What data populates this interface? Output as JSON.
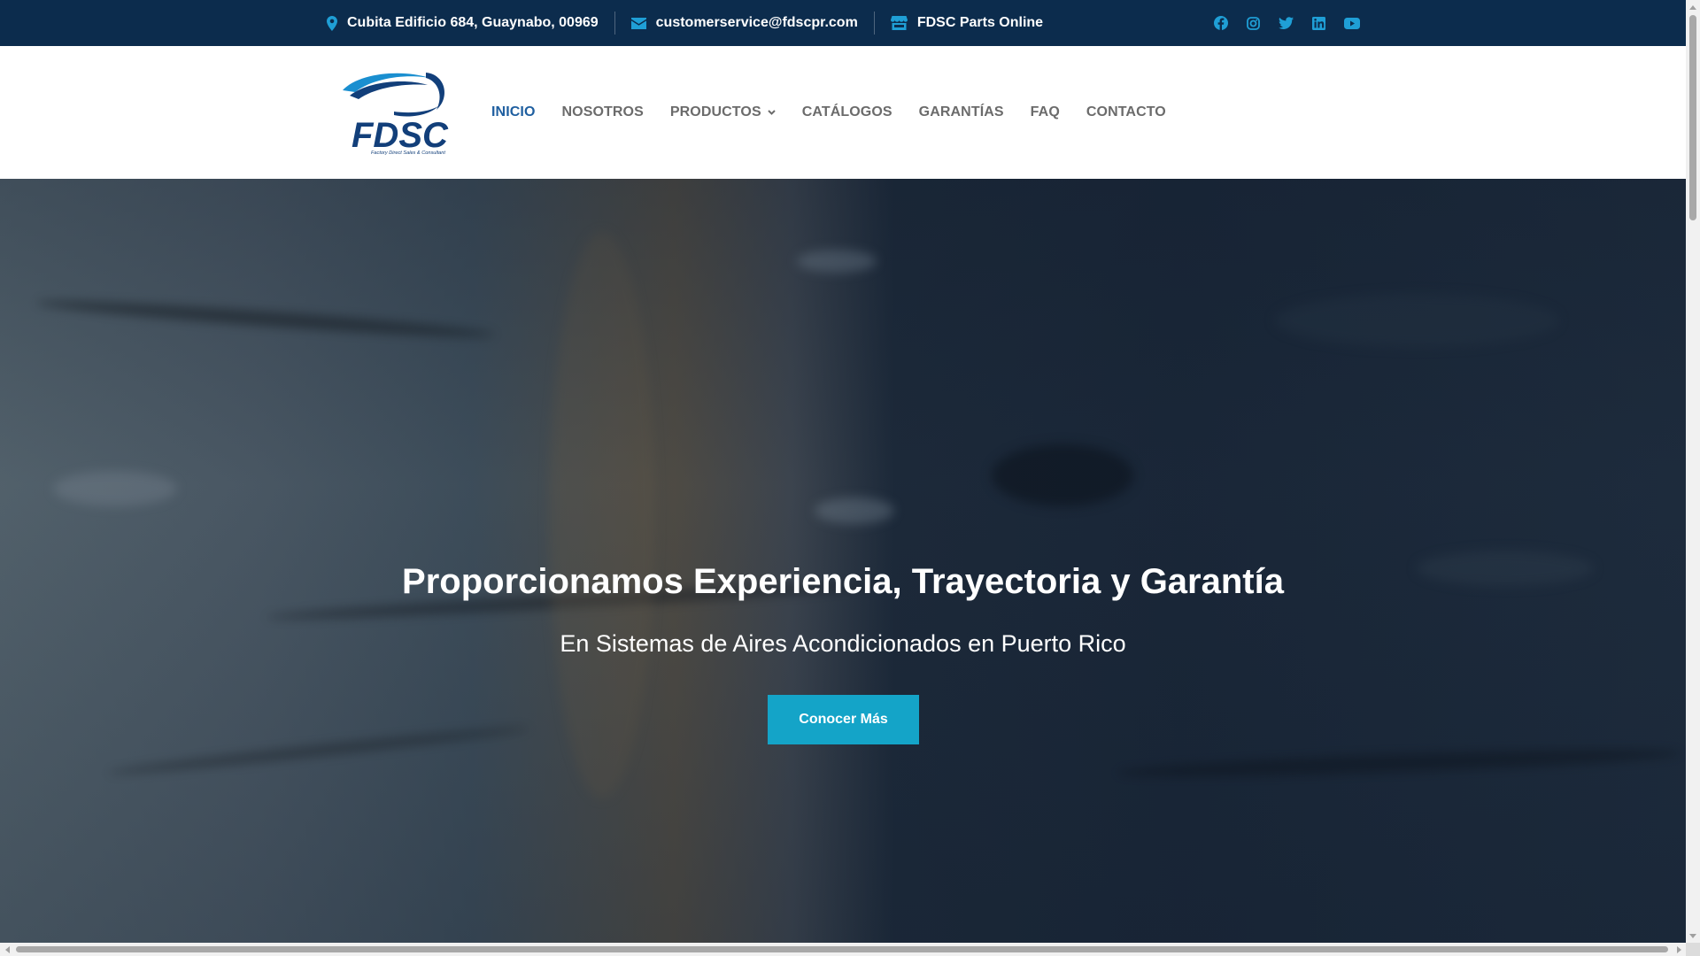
{
  "colors": {
    "topbar_bg": "#0c2c4d",
    "accent": "#1f9fd6",
    "nav_active": "#1f5fa0",
    "nav_text": "#6b6b6b",
    "button_bg": "#14a4c8"
  },
  "topbar": {
    "address": "Cubita Edificio 684, Guaynabo, 00969",
    "email": "customerservice@fdscpr.com",
    "store": "FDSC Parts Online",
    "icons": [
      "map-pin-icon",
      "envelope-icon",
      "store-icon"
    ],
    "socials": [
      "facebook-icon",
      "instagram-icon",
      "twitter-icon",
      "linkedin-icon",
      "youtube-icon"
    ]
  },
  "logo": {
    "text": "FDSC",
    "tagline": "Factory Direct Sales & Consultant"
  },
  "nav": {
    "items": [
      {
        "label": "INICIO",
        "active": true
      },
      {
        "label": "NOSOTROS"
      },
      {
        "label": "PRODUCTOS",
        "has_dropdown": true
      },
      {
        "label": "CATÁLOGOS"
      },
      {
        "label": "GARANTÍAS"
      },
      {
        "label": "FAQ"
      },
      {
        "label": "CONTACTO"
      }
    ]
  },
  "hero": {
    "title": "Proporcionamos Experiencia, Trayectoria y Garantía",
    "subtitle": "En Sistemas de Aires Acondicionados en Puerto Rico",
    "button_label": "Conocer Más"
  }
}
